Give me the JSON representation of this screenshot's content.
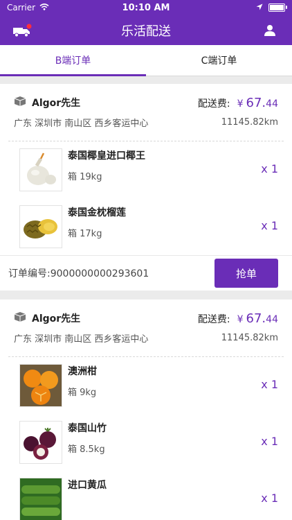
{
  "status_bar": {
    "carrier": "Carrier",
    "time": "10:10 AM",
    "battery_level": 1.0
  },
  "nav": {
    "title": "乐活配送",
    "left_icon": "delivery-truck-icon",
    "right_icon": "user-icon"
  },
  "tabs": [
    {
      "label": "B端订单",
      "active": true
    },
    {
      "label": "C端订单",
      "active": false
    }
  ],
  "orders": [
    {
      "customer": "Algor先生",
      "fee_label": "配送费:",
      "currency": "¥",
      "fee_int": "67.",
      "fee_dec": "44",
      "address": "广东 深圳市 南山区 西乡客运中心",
      "distance": "11145.82km",
      "items": [
        {
          "name": "泰国椰皇进口椰王",
          "spec": "箱 19kg",
          "qty": "x 1",
          "icon": "coconut"
        },
        {
          "name": "泰国金枕榴莲",
          "spec": "箱 17kg",
          "qty": "x 1",
          "icon": "durian"
        }
      ],
      "order_no": "订单编号:9000000000293601",
      "button_label": "抢单"
    },
    {
      "customer": "Algor先生",
      "fee_label": "配送费:",
      "currency": "¥",
      "fee_int": "67.",
      "fee_dec": "44",
      "address": "广东 深圳市 南山区 西乡客运中心",
      "distance": "11145.82km",
      "items": [
        {
          "name": "澳洲柑",
          "spec": "箱 9kg",
          "qty": "x 1",
          "icon": "orange"
        },
        {
          "name": "泰国山竹",
          "spec": "箱 8.5kg",
          "qty": "x 1",
          "icon": "mangosteen"
        },
        {
          "name": "进口黄瓜",
          "spec": "",
          "qty": "x 1",
          "icon": "cucumber"
        }
      ]
    }
  ],
  "colors": {
    "brand": "#6a2db7",
    "background": "#ebebeb"
  }
}
